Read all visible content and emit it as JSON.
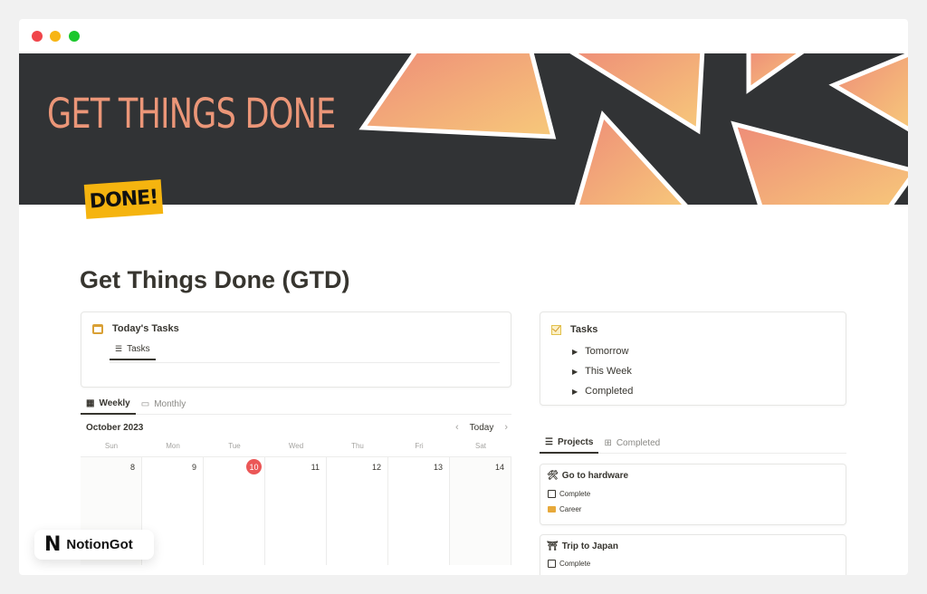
{
  "window": {
    "controls": [
      "close",
      "minimize",
      "maximize"
    ]
  },
  "cover": {
    "title": "GET THINGS DONE",
    "sticker": "DONE!"
  },
  "page": {
    "title": "Get Things Done (GTD)"
  },
  "todays_tasks": {
    "title": "Today's Tasks",
    "icon": "calendar-icon",
    "tab": "Tasks"
  },
  "calendar": {
    "view_tabs": [
      {
        "label": "Weekly",
        "icon": "calendar-grid-icon",
        "active": true
      },
      {
        "label": "Monthly",
        "icon": "calendar-icon",
        "active": false
      }
    ],
    "month": "October 2023",
    "today_button": "Today",
    "weekdays": [
      "Sun",
      "Mon",
      "Tue",
      "Wed",
      "Thu",
      "Fri",
      "Sat"
    ],
    "days": [
      "8",
      "9",
      "10",
      "11",
      "12",
      "13",
      "14"
    ],
    "today": "10"
  },
  "tasks": {
    "title": "Tasks",
    "icon": "checkbox-icon",
    "toggles": [
      "Tomorrow",
      "This Week",
      "Completed"
    ]
  },
  "projects": {
    "tabs": [
      {
        "label": "Projects",
        "icon": "checklist-icon",
        "active": true
      },
      {
        "label": "Completed",
        "icon": "gallery-icon",
        "active": false
      }
    ],
    "cards": [
      {
        "emoji": "🛠",
        "title": "Go to hardware",
        "checkbox_label": "Complete",
        "tag": "Career"
      },
      {
        "emoji": "⛩",
        "title": "Trip to Japan",
        "checkbox_label": "Complete"
      }
    ]
  },
  "brand": {
    "logo": "N",
    "name": "NotionGot"
  }
}
